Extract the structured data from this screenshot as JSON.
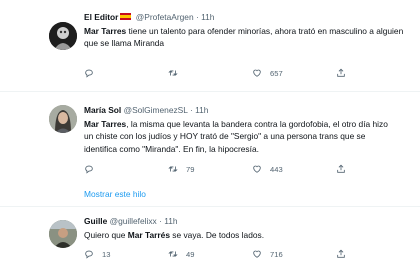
{
  "tweets": [
    {
      "name": "El Editor",
      "handle": "@ProfetaArgen",
      "time": "11h",
      "mention": "Mar Tarres",
      "text": " tiene un talento para ofender minorías, ahora trató en masculino a alguien que se llama Miranda",
      "replies": "",
      "retweets": "",
      "likes": "657"
    },
    {
      "name": "María Sol",
      "handle": "@SolGimenezSL",
      "time": "11h",
      "mention": "Mar Tarres",
      "text": ", la misma que levanta la bandera contra la gordofobia, el otro día hizo un chiste con los judíos y HOY trató de \"Sergio\" a una persona trans que se identifica como \"Miranda\". En fin, la hipocresía.",
      "replies": "",
      "retweets": "79",
      "likes": "443"
    },
    {
      "name": "Guille",
      "handle": "@guillefelixx",
      "time": "11h",
      "pre": "Quiero que ",
      "mention": "Mar Tarrés",
      "text": " se vaya. De todos lados.",
      "replies": "13",
      "retweets": "49",
      "likes": "716"
    }
  ],
  "dot": "·",
  "show_thread": "Mostrar este hilo",
  "colors": {
    "link": "#1d9bf0",
    "muted": "#536471",
    "border": "#eff3f4"
  }
}
